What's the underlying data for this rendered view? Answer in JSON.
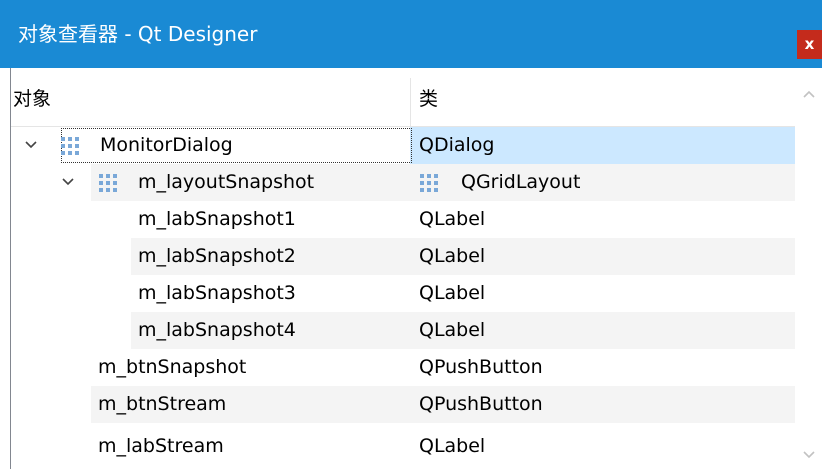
{
  "window": {
    "title": "对象查看器 - Qt Designer",
    "close_label": "x",
    "title_bar_color": "#1a8ad4"
  },
  "columns": {
    "object": "对象",
    "class": "类"
  },
  "rows": [
    {
      "name": "MonitorDialog",
      "class": "QDialog",
      "level": 0,
      "expanded": true,
      "icon": "grid-layout-icon",
      "selected": true
    },
    {
      "name": "m_layoutSnapshot",
      "class": "QGridLayout",
      "level": 1,
      "expanded": true,
      "icon": "grid-layout-icon",
      "class_icon": "grid-layout-icon"
    },
    {
      "name": "m_labSnapshot1",
      "class": "QLabel",
      "level": 2
    },
    {
      "name": "m_labSnapshot2",
      "class": "QLabel",
      "level": 2
    },
    {
      "name": "m_labSnapshot3",
      "class": "QLabel",
      "level": 2
    },
    {
      "name": "m_labSnapshot4",
      "class": "QLabel",
      "level": 2
    },
    {
      "name": "m_btnSnapshot",
      "class": "QPushButton",
      "level": 1
    },
    {
      "name": "m_btnStream",
      "class": "QPushButton",
      "level": 1
    },
    {
      "name": "m_labStream",
      "class": "QLabel",
      "level": 1
    }
  ],
  "scrollbar": {
    "up_icon": "chevron-up-icon",
    "down_icon": "chevron-down-icon"
  }
}
